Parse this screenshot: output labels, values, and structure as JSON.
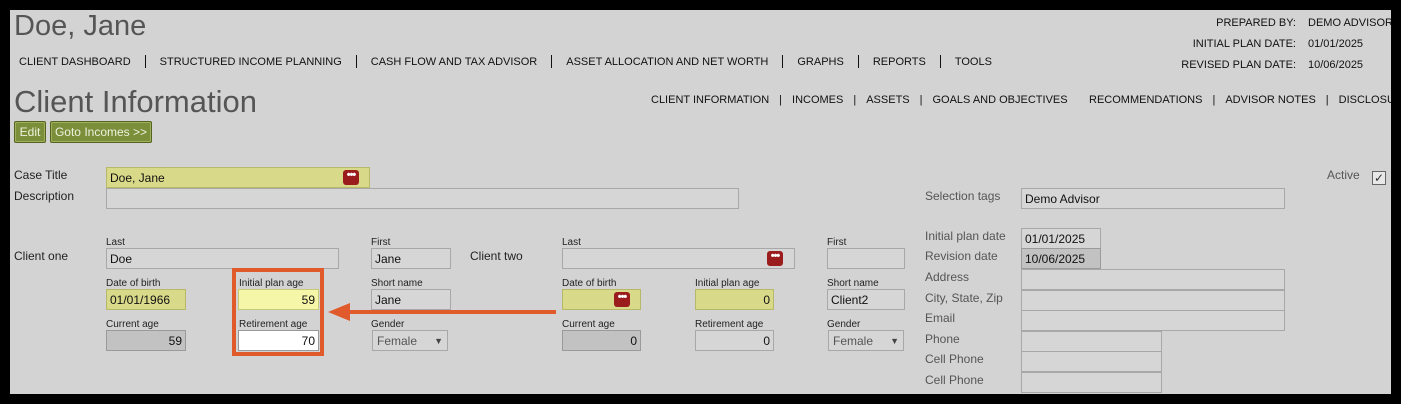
{
  "header": {
    "client_name": "Doe, Jane",
    "prepared_by_label": "PREPARED BY:",
    "prepared_by_value": "DEMO ADVISOR",
    "initial_plan_label": "INITIAL PLAN DATE:",
    "initial_plan_value": "01/01/2025",
    "revised_plan_label": "REVISED PLAN DATE:",
    "revised_plan_value": "10/06/2025"
  },
  "nav": [
    "CLIENT DASHBOARD",
    "STRUCTURED INCOME PLANNING",
    "CASH FLOW AND TAX ADVISOR",
    "ASSET ALLOCATION AND NET WORTH",
    "GRAPHS",
    "REPORTS",
    "TOOLS"
  ],
  "page_title": "Client Information",
  "subnav": [
    "CLIENT INFORMATION",
    "INCOMES",
    "ASSETS",
    "GOALS AND OBJECTIVES"
  ],
  "subnav2": [
    "RECOMMENDATIONS",
    "ADVISOR NOTES",
    "DISCLOSURE"
  ],
  "buttons": {
    "edit": "Edit",
    "goto": "Goto Incomes >>"
  },
  "case": {
    "title_label": "Case Title",
    "title_value": "Doe, Jane",
    "description_label": "Description",
    "description_value": "",
    "active_label": "Active",
    "active_mark": "✓"
  },
  "client_one": {
    "label": "Client one",
    "last_label": "Last",
    "last_value": "Doe",
    "first_label": "First",
    "first_value": "Jane",
    "dob_label": "Date of birth",
    "dob_value": "01/01/1966",
    "initial_age_label": "Initial plan age",
    "initial_age_value": "59",
    "short_label": "Short name",
    "short_value": "Jane",
    "current_age_label": "Current age",
    "current_age_value": "59",
    "retirement_age_label": "Retirement age",
    "retirement_age_value": "70",
    "gender_label": "Gender",
    "gender_value": "Female"
  },
  "client_two": {
    "label": "Client two",
    "last_label": "Last",
    "last_value": "",
    "first_label": "First",
    "first_value": "",
    "dob_label": "Date of birth",
    "dob_value": "",
    "initial_age_label": "Initial plan age",
    "initial_age_value": "0",
    "short_label": "Short name",
    "short_value": "Client2",
    "current_age_label": "Current age",
    "current_age_value": "0",
    "retirement_age_label": "Retirement age",
    "retirement_age_value": "0",
    "gender_label": "Gender",
    "gender_value": "Female"
  },
  "right_panel": {
    "selection_tags_label": "Selection tags",
    "selection_tags_value": "Demo Advisor",
    "initial_plan_date_label": "Initial plan date",
    "initial_plan_date_value": "01/01/2025",
    "revision_date_label": "Revision date",
    "revision_date_value": "10/06/2025",
    "address_label": "Address",
    "city_label": "City, State, Zip",
    "email_label": "Email",
    "phone_label": "Phone",
    "cell1_label": "Cell Phone",
    "cell2_label": "Cell Phone"
  },
  "colors": {
    "accent": "#e05a2b",
    "button": "#7b8f3a",
    "field_yellow": "#d9d98a",
    "icon_red": "#9b1c1c"
  }
}
